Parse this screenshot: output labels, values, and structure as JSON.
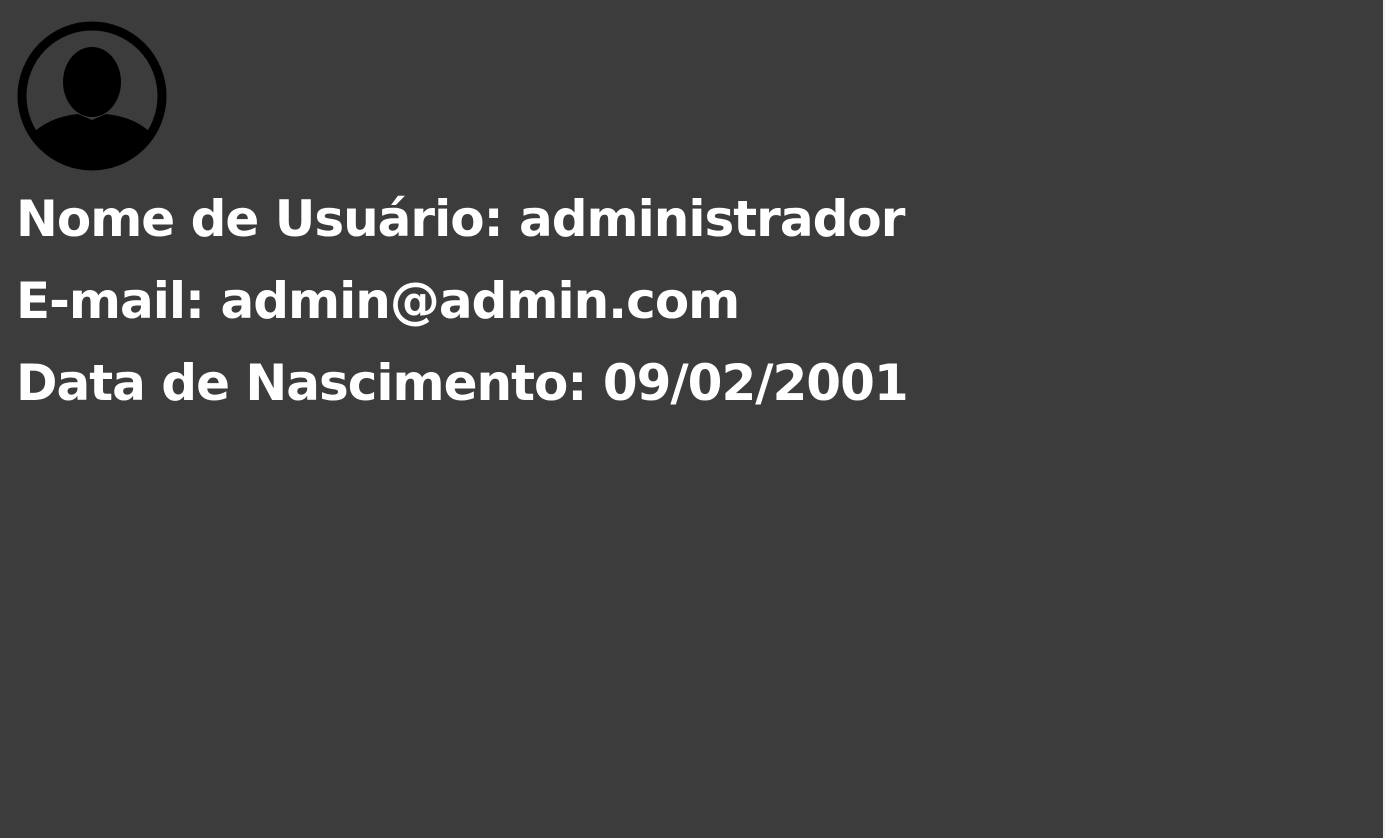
{
  "profile": {
    "avatar_icon": "user-avatar-icon",
    "username_label": "Nome de Usuário:",
    "username_value": "administrador",
    "email_label": "E-mail:",
    "email_value": "admin@admin.com",
    "birthdate_label": "Data de Nascimento:",
    "birthdate_value": "09/02/2001"
  },
  "colors": {
    "background": "#3c3c3c",
    "text": "#ffffff",
    "icon": "#000000",
    "edge": "#f2f2f2"
  }
}
